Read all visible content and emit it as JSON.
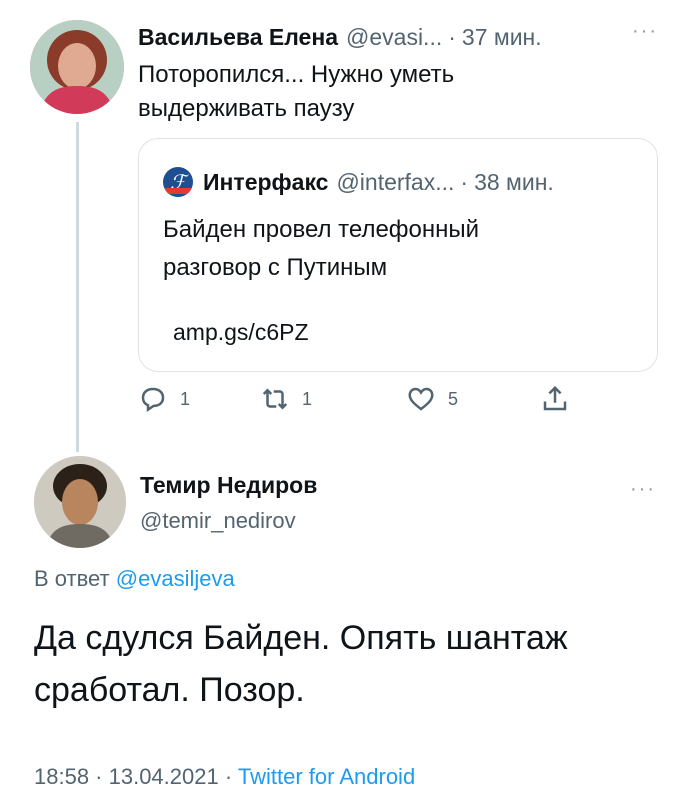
{
  "tweet": {
    "author_name": "Васильева Елена",
    "author_handle": "@evasi...",
    "separator": "·",
    "time": "37 мин.",
    "more": "···",
    "text_line1": "Поторопился... Нужно уметь",
    "text_line2": "выдерживать паузу",
    "quote": {
      "author_name": "Интерфакс",
      "author_handle": "@interfax...",
      "separator": "·",
      "time": "38 мин.",
      "text_line1": "Байден провел телефонный",
      "text_line2": "разговор с Путиным",
      "link": "amp.gs/c6PZ"
    },
    "actions": {
      "reply_count": "1",
      "retweet_count": "1",
      "like_count": "5"
    }
  },
  "reply": {
    "author_name": "Темир Недиров",
    "author_handle": "@temir_nedirov",
    "more": "···",
    "reply_prefix": "В ответ",
    "reply_mention": "@evasiljeva",
    "text_line1": "Да сдулся Байден. Опять шантаж",
    "text_line2": "сработал. Позор.",
    "timestamp": "18:58 · 13.04.2021 ·",
    "client": "Twitter for Android"
  },
  "icons": {
    "reply": "reply-icon",
    "retweet": "retweet-icon",
    "like": "heart-icon",
    "share": "share-icon",
    "more": "more-icon"
  },
  "colors": {
    "link_blue": "#1d9bf0",
    "secondary_text": "#536471",
    "border": "#dfe3e6"
  }
}
